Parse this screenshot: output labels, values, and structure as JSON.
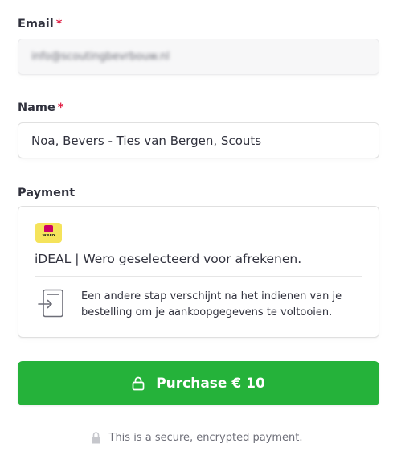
{
  "email": {
    "label": "Email",
    "required_mark": "*",
    "value": "info@scoutingbevrbouw.nl"
  },
  "name": {
    "label": "Name",
    "required_mark": "*",
    "value": "Noa, Bevers - Ties van Bergen, Scouts"
  },
  "payment": {
    "label": "Payment",
    "logo_text": "wero",
    "selected_text": "iDEAL | Wero geselecteerd voor afrekenen.",
    "redirect_text": "Een andere stap verschijnt na het indienen van je bestelling om je aankoopgegevens te voltooien."
  },
  "purchase_button": {
    "label": "Purchase € 10",
    "color": "#25b23a"
  },
  "secure_note": "This is a secure, encrypted payment.",
  "colors": {
    "required": "#df1b41",
    "text": "#30313d",
    "muted": "#6d6e78",
    "logo_bg": "#f5e35b",
    "ideal_pink": "#cc0066"
  },
  "icons": {
    "redirect": "redirect-icon",
    "lock": "lock-icon"
  }
}
